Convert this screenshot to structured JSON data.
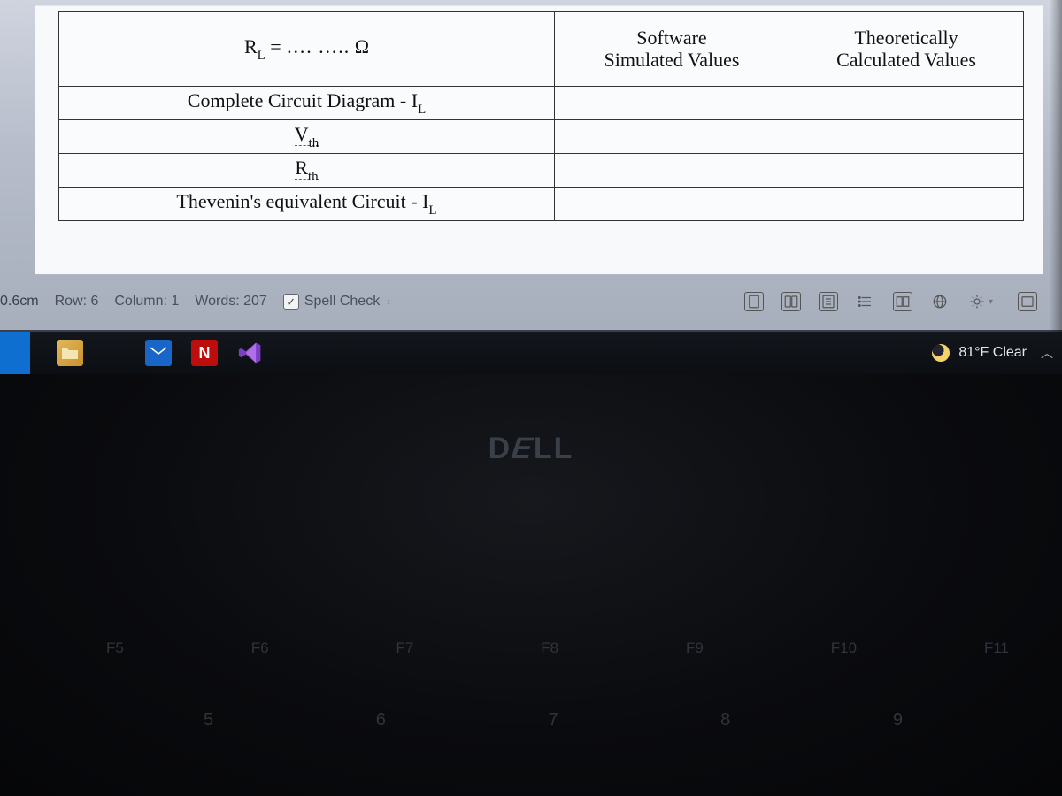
{
  "table": {
    "header": {
      "col1_html": "R<sub>L</sub> = … … … Ω",
      "col1_rl": "R",
      "col1_l": "L",
      "col1_eq": " = ",
      "col1_dots": "…. …..",
      "col1_ohm": " Ω",
      "col2_line1": "Software",
      "col2_line2": "Simulated Values",
      "col3_line1": "Theoretically",
      "col3_line2": "Calculated Values"
    },
    "rows": [
      {
        "label_pre": "Complete Circuit Diagram - I",
        "label_sub": "L",
        "v2": "",
        "v3": ""
      },
      {
        "label_pre": "V",
        "label_sub": "th",
        "v2": "",
        "v3": "",
        "und": true
      },
      {
        "label_pre": "R",
        "label_sub": "th",
        "v2": "",
        "v3": "",
        "und": true
      },
      {
        "label_pre": "Thevenin's equivalent Circuit - I",
        "label_sub": "L",
        "v2": "",
        "v3": ""
      }
    ]
  },
  "status": {
    "measure": "0.6cm",
    "row": "Row: 6",
    "column": "Column: 1",
    "words": "Words: 207",
    "spell": "Spell Check"
  },
  "taskbar": {
    "weather": "81°F Clear"
  },
  "logo": "D LL",
  "keys_fn": [
    "F5",
    "F6",
    "F7",
    "F8",
    "F9",
    "F10",
    "F11"
  ],
  "keys_num": [
    "5",
    "6",
    "7",
    "8",
    "9"
  ]
}
